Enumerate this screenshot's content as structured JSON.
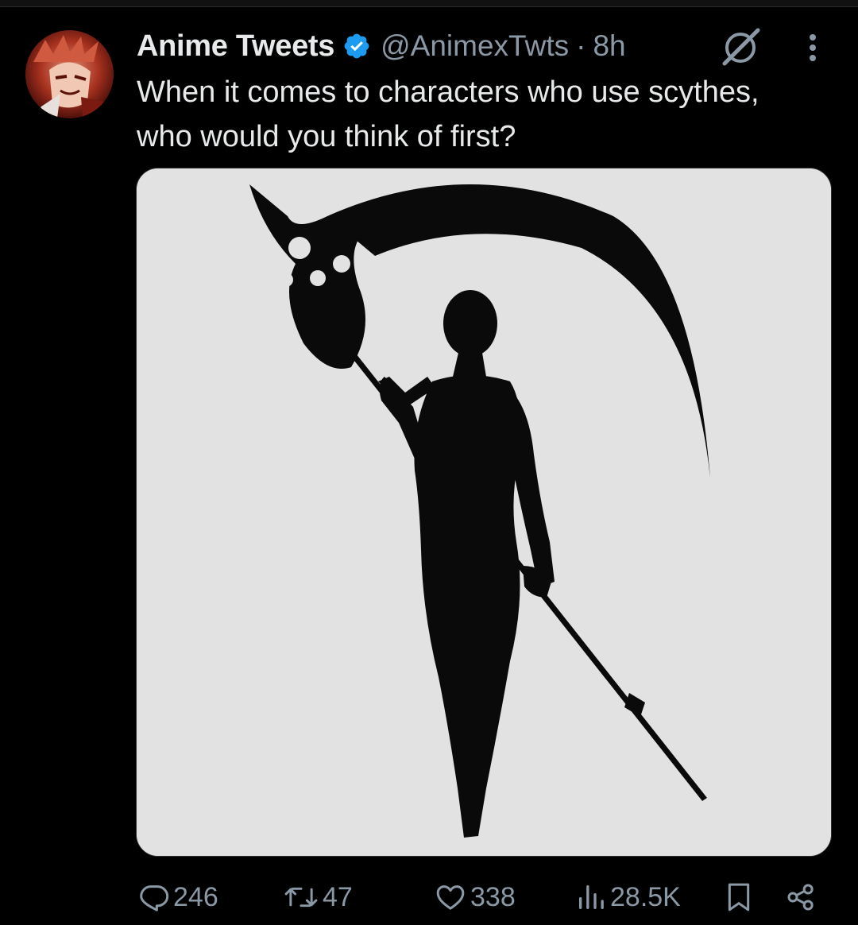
{
  "tweet": {
    "display_name": "Anime Tweets",
    "verified": true,
    "handle": "@AnimexTwts",
    "separator": "·",
    "timestamp": "8h",
    "text": "When it comes to characters who use scythes,\nwho would you think of first?",
    "media_alt_icon": "silhouette-with-scythe"
  },
  "actions": {
    "replies": "246",
    "reposts": "47",
    "likes": "338",
    "views": "28.5K"
  },
  "icons": {
    "avatar": "avatar-icon",
    "verified": "verified-badge-icon",
    "grok": "grok-icon",
    "more": "more-vertical-icon",
    "reply": "reply-icon",
    "repost": "repost-icon",
    "like": "heart-icon",
    "views": "views-icon",
    "bookmark": "bookmark-icon",
    "share": "share-icon"
  },
  "colors": {
    "background": "#000000",
    "text": "#e7e9ea",
    "secondary": "#8b98a5",
    "verified": "#1d9bf0",
    "media_bg": "#e2e2e2"
  }
}
